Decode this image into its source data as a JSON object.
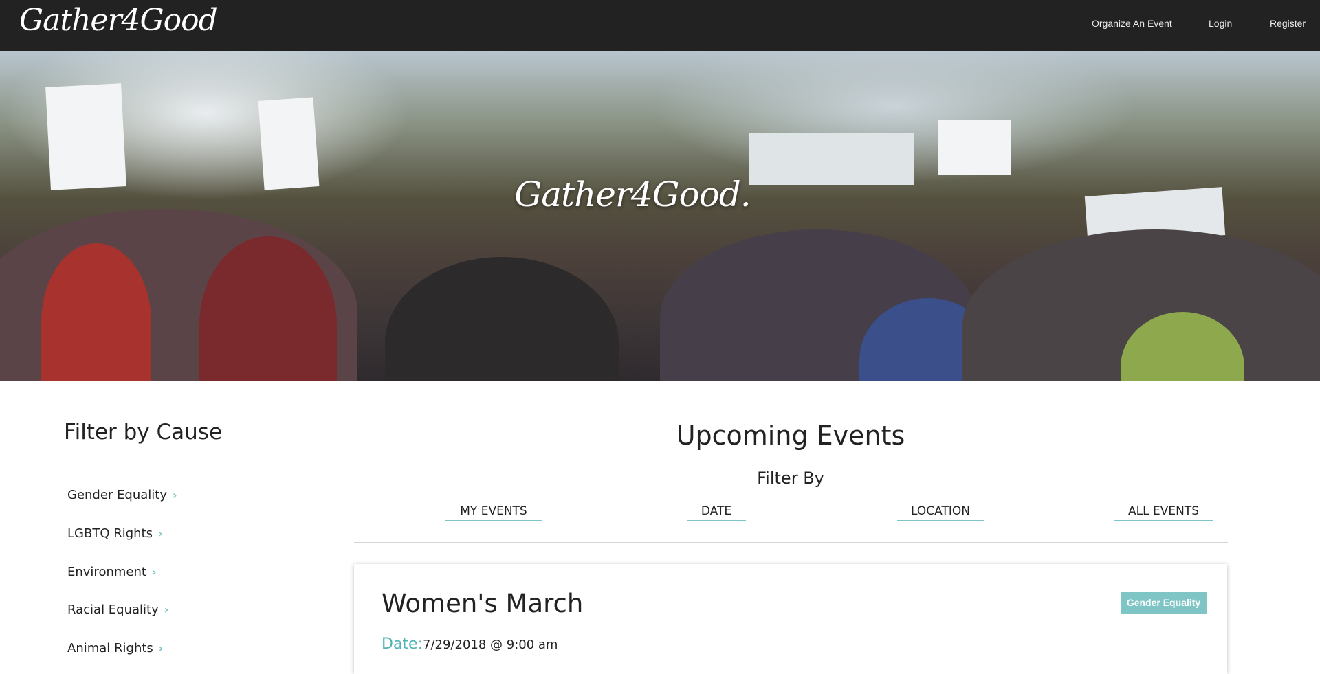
{
  "navbar": {
    "brand": "Gather4Good",
    "links": [
      "Organize An Event",
      "Login",
      "Register"
    ]
  },
  "hero": {
    "title": "Gather4Good."
  },
  "sidebar": {
    "title": "Filter by Cause",
    "causes": [
      "Gender Equality",
      "LGBTQ Rights",
      "Environment",
      "Racial Equality",
      "Animal Rights"
    ]
  },
  "main": {
    "title": "Upcoming Events",
    "filter_label": "Filter By",
    "filter_tabs": [
      "MY EVENTS",
      "DATE",
      "LOCATION",
      "ALL EVENTS"
    ]
  },
  "events": [
    {
      "title": "Women's March",
      "cause": "Gender Equality",
      "date_label": "Date:",
      "date_value": "7/29/2018 @ 9:00 am"
    }
  ],
  "colors": {
    "navbar_bg": "#222222",
    "accent": "#7fc5c6",
    "date_label": "#4fb3b5"
  }
}
